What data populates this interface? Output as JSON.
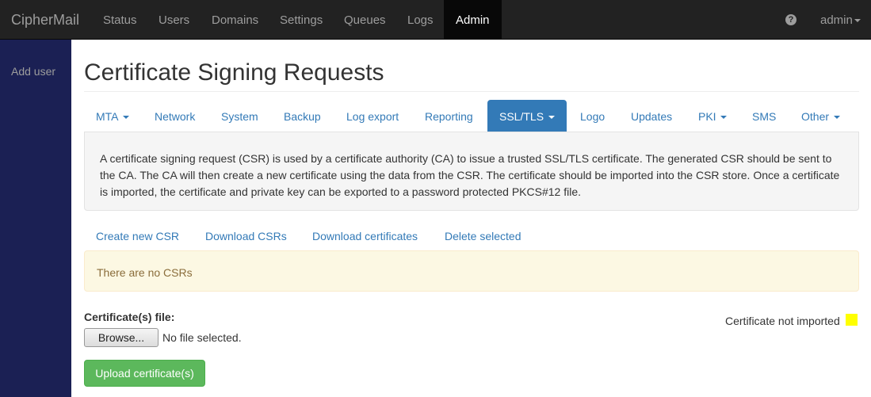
{
  "navbar": {
    "brand": "CipherMail",
    "items": [
      {
        "label": "Status"
      },
      {
        "label": "Users"
      },
      {
        "label": "Domains"
      },
      {
        "label": "Settings"
      },
      {
        "label": "Queues"
      },
      {
        "label": "Logs"
      },
      {
        "label": "Admin"
      }
    ],
    "help_icon": "question-circle-icon",
    "help_glyph": "?",
    "user_label": "admin"
  },
  "sidebar": {
    "items": [
      {
        "label": "Add user"
      }
    ]
  },
  "page": {
    "title": "Certificate Signing Requests"
  },
  "tabs": [
    {
      "label": "MTA"
    },
    {
      "label": "Network"
    },
    {
      "label": "System"
    },
    {
      "label": "Backup"
    },
    {
      "label": "Log export"
    },
    {
      "label": "Reporting"
    },
    {
      "label": "SSL/TLS"
    },
    {
      "label": "Logo"
    },
    {
      "label": "Updates"
    },
    {
      "label": "PKI"
    },
    {
      "label": "SMS"
    },
    {
      "label": "Other"
    }
  ],
  "info": {
    "text": "A certificate signing request (CSR) is used by a certificate authority (CA) to issue a trusted SSL/TLS certificate. The generated CSR should be sent to the CA. The CA will then create a new certificate using the data from the CSR. The certificate should be imported into the CSR store. Once a certificate is imported, the certificate and private key can be exported to a password protected PKCS#12 file."
  },
  "actions": [
    {
      "label": "Create new CSR"
    },
    {
      "label": "Download CSRs"
    },
    {
      "label": "Download certificates"
    },
    {
      "label": "Delete selected"
    }
  ],
  "alert": {
    "text": "There are no CSRs"
  },
  "upload": {
    "file_label": "Certificate(s) file:",
    "browse_label": "Browse...",
    "no_file_text": "No file selected.",
    "upload_label": "Upload certificate(s)"
  },
  "status": {
    "text": "Certificate not imported",
    "color": "#ffff00"
  },
  "colors": {
    "navbar_bg": "#222222",
    "sidebar_bg": "#1b2054",
    "link": "#337ab7",
    "success": "#5cb85c",
    "warning_bg": "#fcf8e3"
  }
}
